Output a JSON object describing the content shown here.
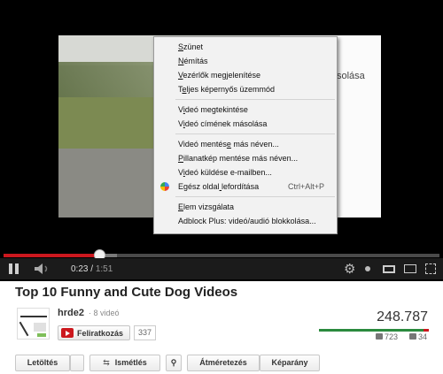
{
  "player": {
    "overlay_text": "solása",
    "time_current": "0:23",
    "time_duration": "1:51",
    "progress_fraction": 0.22
  },
  "context_menu": {
    "items": [
      {
        "label": "Szünet",
        "shortcut": ""
      },
      {
        "label": "Némítás",
        "shortcut": ""
      },
      {
        "label": "Vezérlők megjelenítése",
        "shortcut": ""
      },
      {
        "label": "Teljes képernyős üzemmód",
        "shortcut": ""
      },
      {
        "label": "Videó megtekintése",
        "shortcut": ""
      },
      {
        "label": "Videó címének másolása",
        "shortcut": ""
      },
      {
        "label": "Videó mentése más néven...",
        "shortcut": ""
      },
      {
        "label": "Pillanatkép mentése más néven...",
        "shortcut": ""
      },
      {
        "label": "Videó küldése e-mailben...",
        "shortcut": ""
      },
      {
        "label": "Egész oldal lefordítása",
        "shortcut": "Ctrl+Alt+P",
        "icon": "google-translate-icon"
      },
      {
        "label": "Elem vizsgálata",
        "shortcut": ""
      },
      {
        "label": "Adblock Plus: videó/audió blokkolása...",
        "shortcut": ""
      }
    ]
  },
  "video": {
    "title": "Top 10 Funny and Cute Dog Videos",
    "channel": "hrde2",
    "video_count": "· 8 videó",
    "subscribe_label": "Feliratkozás",
    "subscriber_count": "337",
    "views": "248.787",
    "likes": "723",
    "dislikes": "34",
    "like_ratio": 0.955
  },
  "actions": {
    "download": "Letöltés",
    "loop": "Ismétlés",
    "resize": "Átméretezés",
    "aspect": "Képarány"
  },
  "colors": {
    "accent_red": "#cc181e",
    "like_green": "#2b8a3e"
  }
}
